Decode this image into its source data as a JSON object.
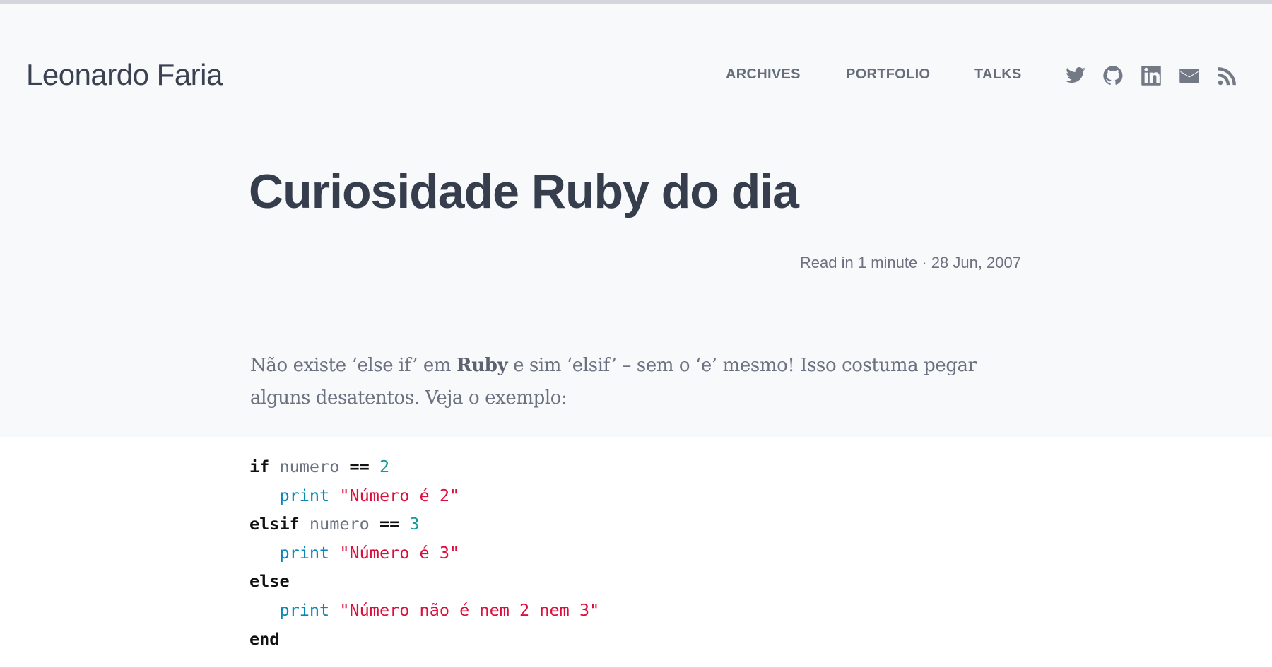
{
  "header": {
    "logo": "Leonardo Faria",
    "nav": [
      {
        "label": "ARCHIVES"
      },
      {
        "label": "PORTFOLIO"
      },
      {
        "label": "TALKS"
      }
    ],
    "social_icons": [
      "twitter-icon",
      "github-icon",
      "linkedin-icon",
      "email-icon",
      "rss-icon"
    ]
  },
  "post": {
    "title": "Curiosidade Ruby do dia",
    "meta": "Read in 1 minute · 28 Jun, 2007",
    "para_part1": "Não existe ‘else if’ em ",
    "para_bold": "Ruby",
    "para_part2": " e sim ‘elsif’ – sem o ‘e’ mesmo! Isso costuma pegar alguns desatentos. Veja o exemplo:",
    "code": {
      "l1": {
        "kw": "if",
        "var": "numero",
        "op": "==",
        "num": "2"
      },
      "l2": {
        "fn": "print",
        "str": "\"Número é 2\""
      },
      "l3": {
        "kw": "elsif",
        "var": "numero",
        "op": "==",
        "num": "3"
      },
      "l4": {
        "fn": "print",
        "str": "\"Número é 3\""
      },
      "l5": {
        "kw": "else"
      },
      "l6": {
        "fn": "print",
        "str": "\"Número não é nem 2 nem 3\""
      },
      "l7": {
        "kw": "end"
      }
    }
  },
  "colors": {
    "keyword": "#111111",
    "string": "#dc0f3c",
    "number": "#0f9b95",
    "function": "#0a86b8"
  }
}
